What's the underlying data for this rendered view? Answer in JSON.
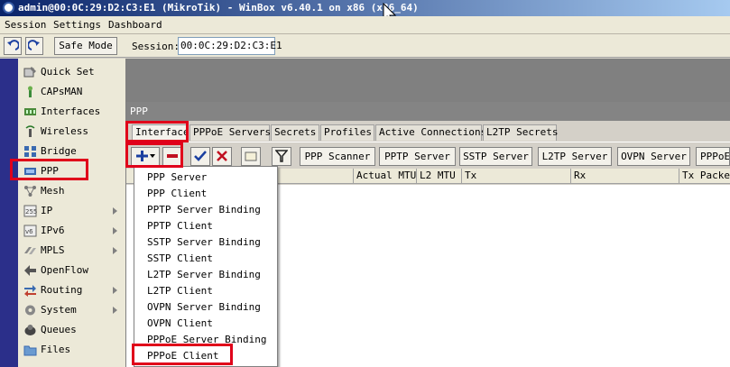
{
  "window": {
    "title": "admin@00:0C:29:D2:C3:E1 (MikroTik) - WinBox v6.40.1 on x86 (x86_64)"
  },
  "menubar": {
    "items": [
      "Session",
      "Settings",
      "Dashboard"
    ]
  },
  "toolbar": {
    "undo_icon": "undo-icon",
    "redo_icon": "redo-icon",
    "safe_mode_label": "Safe Mode",
    "session_label": "Session:",
    "session_value": "00:0C:29:D2:C3:E1"
  },
  "sidebar": {
    "items": [
      {
        "label": "Quick Set",
        "icon": "quick-set-icon"
      },
      {
        "label": "CAPsMAN",
        "icon": "capsman-icon"
      },
      {
        "label": "Interfaces",
        "icon": "interfaces-icon"
      },
      {
        "label": "Wireless",
        "icon": "wireless-icon"
      },
      {
        "label": "Bridge",
        "icon": "bridge-icon"
      },
      {
        "label": "PPP",
        "icon": "ppp-icon"
      },
      {
        "label": "Mesh",
        "icon": "mesh-icon"
      },
      {
        "label": "IP",
        "icon": "ip-icon",
        "submenu": true
      },
      {
        "label": "IPv6",
        "icon": "ipv6-icon",
        "submenu": true
      },
      {
        "label": "MPLS",
        "icon": "mpls-icon",
        "submenu": true
      },
      {
        "label": "OpenFlow",
        "icon": "openflow-icon"
      },
      {
        "label": "Routing",
        "icon": "routing-icon",
        "submenu": true
      },
      {
        "label": "System",
        "icon": "system-icon",
        "submenu": true
      },
      {
        "label": "Queues",
        "icon": "queues-icon"
      },
      {
        "label": "Files",
        "icon": "files-icon"
      }
    ]
  },
  "ppp": {
    "title": "PPP",
    "tabs": [
      "Interface",
      "PPPoE Servers",
      "Secrets",
      "Profiles",
      "Active Connections",
      "L2TP Secrets"
    ],
    "toolbar": {
      "buttons": [
        "PPP Scanner",
        "PPTP Server",
        "SSTP Server",
        "L2TP Server",
        "OVPN Server",
        "PPPoE"
      ]
    },
    "columns": [
      "Actual MTU",
      "L2 MTU",
      "Tx",
      "Rx",
      "Tx Packet"
    ]
  },
  "dropdown": {
    "items": [
      "PPP Server",
      "PPP Client",
      "PPTP Server Binding",
      "PPTP Client",
      "SSTP Server Binding",
      "SSTP Client",
      "L2TP Server Binding",
      "L2TP Client",
      "OVPN Server Binding",
      "OVPN Client",
      "PPPoE Server Binding",
      "PPPoE Client"
    ]
  },
  "colors": {
    "highlight": "#e0001a",
    "title_bar_start": "#0a246a",
    "title_bar_end": "#a6caf0",
    "side_strip": "#2b2f8a",
    "workspace": "#808080"
  }
}
